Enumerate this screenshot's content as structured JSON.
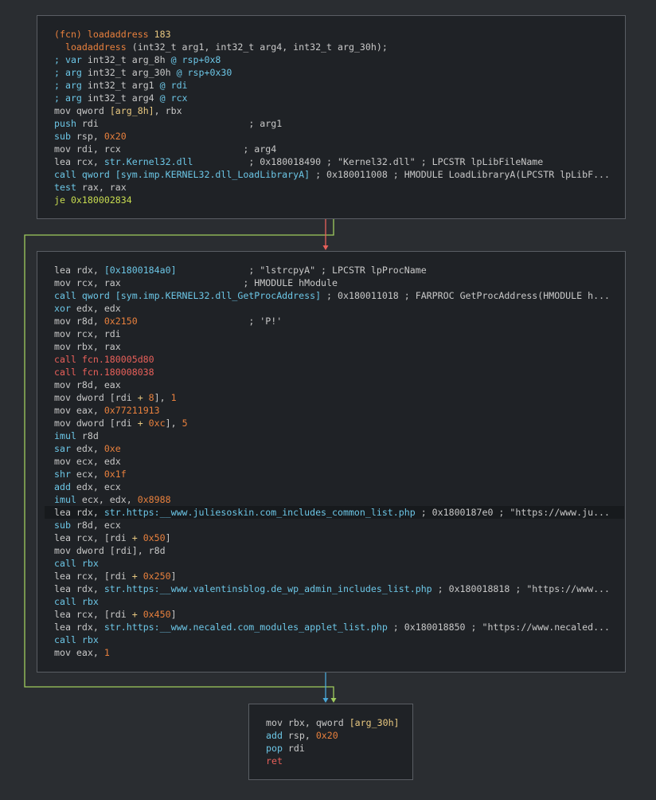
{
  "colors": {
    "background": "#2a2d31",
    "block_bg": "#1f2226",
    "block_border": "#5a5e64",
    "edge_true": "#9fcc5e",
    "edge_false": "#e8605a",
    "edge_uncond": "#4aa8d8"
  },
  "blocks": [
    {
      "id": "block-entry",
      "lines": [
        [
          [
            "c-fcn",
            "(fcn) loadaddress "
          ],
          [
            "c-num2",
            "183"
          ]
        ],
        [
          [
            "c-def",
            "  "
          ],
          [
            "c-fcn",
            "loadaddress"
          ],
          [
            "c-def",
            " (int32_t arg1, int32_t arg4, int32_t arg_30h);"
          ]
        ],
        [
          [
            "c-cmt",
            "; var "
          ],
          [
            "c-def",
            "int32_t arg_8h "
          ],
          [
            "c-cmt",
            "@ rsp+0x8"
          ]
        ],
        [
          [
            "c-cmt",
            "; arg "
          ],
          [
            "c-def",
            "int32_t arg_30h "
          ],
          [
            "c-cmt",
            "@ rsp+0x30"
          ]
        ],
        [
          [
            "c-cmt",
            "; arg "
          ],
          [
            "c-def",
            "int32_t arg1 "
          ],
          [
            "c-cmt",
            "@ rdi"
          ]
        ],
        [
          [
            "c-cmt",
            "; arg "
          ],
          [
            "c-def",
            "int32_t arg4 "
          ],
          [
            "c-cmt",
            "@ rcx"
          ]
        ],
        [
          [
            "c-mnem",
            "mov "
          ],
          [
            "c-reg",
            "qword "
          ],
          [
            "c-stack",
            "[arg_8h]"
          ],
          [
            "c-reg",
            ", rbx"
          ]
        ],
        [
          [
            "c-ctrl",
            "push "
          ],
          [
            "c-reg",
            "rdi                           "
          ],
          [
            "c-ref",
            "; arg1"
          ]
        ],
        [
          [
            "c-ctrl",
            "sub "
          ],
          [
            "c-reg",
            "rsp, "
          ],
          [
            "c-num",
            "0x20"
          ]
        ],
        [
          [
            "c-mnem",
            "mov "
          ],
          [
            "c-reg",
            "rdi, rcx                      "
          ],
          [
            "c-ref",
            "; arg4"
          ]
        ],
        [
          [
            "c-mnem",
            "lea "
          ],
          [
            "c-reg",
            "rcx, "
          ],
          [
            "c-sym",
            "str.Kernel32.dll"
          ],
          [
            "c-ref",
            "          ; 0x180018490 ; \"Kernel32.dll\" ; LPCSTR lpLibFileName"
          ]
        ],
        [
          [
            "c-call",
            "call "
          ],
          [
            "c-sym",
            "qword [sym.imp.KERNEL32.dll_LoadLibraryA]"
          ],
          [
            "c-ref",
            " ; 0x180011008 ; HMODULE LoadLibraryA(LPCSTR lpLibF..."
          ]
        ],
        [
          [
            "c-ctrl",
            "test "
          ],
          [
            "c-reg",
            "rax, rax"
          ]
        ],
        [
          [
            "c-cj",
            "je "
          ],
          [
            "c-cj",
            "0x180002834"
          ]
        ]
      ]
    },
    {
      "id": "block-body",
      "lines": [
        [
          [
            "c-mnem",
            "lea "
          ],
          [
            "c-reg",
            "rdx, "
          ],
          [
            "c-sym",
            "[0x1800184a0]"
          ],
          [
            "c-ref",
            "             ; \"lstrcpyA\" ; LPCSTR lpProcName"
          ]
        ],
        [
          [
            "c-mnem",
            "mov "
          ],
          [
            "c-reg",
            "rcx, rax                      "
          ],
          [
            "c-ref",
            "; HMODULE hModule"
          ]
        ],
        [
          [
            "c-call",
            "call "
          ],
          [
            "c-sym",
            "qword [sym.imp.KERNEL32.dll_GetProcAddress]"
          ],
          [
            "c-ref",
            " ; 0x180011018 ; FARPROC GetProcAddress(HMODULE h..."
          ]
        ],
        [
          [
            "c-ctrl",
            "xor "
          ],
          [
            "c-reg",
            "edx, edx"
          ]
        ],
        [
          [
            "c-mnem",
            "mov "
          ],
          [
            "c-reg",
            "r8d, "
          ],
          [
            "c-num",
            "0x2150"
          ],
          [
            "c-ref",
            "                    ; 'P!'"
          ]
        ],
        [
          [
            "c-mnem",
            "mov "
          ],
          [
            "c-reg",
            "rcx, rdi"
          ]
        ],
        [
          [
            "c-mnem",
            "mov "
          ],
          [
            "c-reg",
            "rbx, rax"
          ]
        ],
        [
          [
            "c-func",
            "call "
          ],
          [
            "c-func",
            "fcn.180005d80"
          ]
        ],
        [
          [
            "c-func",
            "call "
          ],
          [
            "c-func",
            "fcn.180008038"
          ]
        ],
        [
          [
            "c-mnem",
            "mov "
          ],
          [
            "c-reg",
            "r8d, eax"
          ]
        ],
        [
          [
            "c-mnem",
            "mov "
          ],
          [
            "c-reg",
            "dword [rdi "
          ],
          [
            "c-op",
            "+ "
          ],
          [
            "c-num",
            "8"
          ],
          [
            "c-reg",
            "], "
          ],
          [
            "c-num",
            "1"
          ]
        ],
        [
          [
            "c-mnem",
            "mov "
          ],
          [
            "c-reg",
            "eax, "
          ],
          [
            "c-num",
            "0x77211913"
          ]
        ],
        [
          [
            "c-mnem",
            "mov "
          ],
          [
            "c-reg",
            "dword [rdi "
          ],
          [
            "c-op",
            "+ "
          ],
          [
            "c-num",
            "0xc"
          ],
          [
            "c-reg",
            "], "
          ],
          [
            "c-num",
            "5"
          ]
        ],
        [
          [
            "c-ctrl",
            "imul "
          ],
          [
            "c-reg",
            "r8d"
          ]
        ],
        [
          [
            "c-ctrl",
            "sar "
          ],
          [
            "c-reg",
            "edx, "
          ],
          [
            "c-num",
            "0xe"
          ]
        ],
        [
          [
            "c-mnem",
            "mov "
          ],
          [
            "c-reg",
            "ecx, edx"
          ]
        ],
        [
          [
            "c-ctrl",
            "shr "
          ],
          [
            "c-reg",
            "ecx, "
          ],
          [
            "c-num",
            "0x1f"
          ]
        ],
        [
          [
            "c-ctrl",
            "add "
          ],
          [
            "c-reg",
            "edx, ecx"
          ]
        ],
        [
          [
            "c-ctrl",
            "imul "
          ],
          [
            "c-reg",
            "ecx, edx, "
          ],
          [
            "c-num",
            "0x8988"
          ]
        ],
        [
          [
            "c-mnem",
            "lea "
          ],
          [
            "c-reg",
            "rdx, "
          ],
          [
            "c-sym",
            "str.https:__www.juliesoskin.com_includes_common_list.php"
          ],
          [
            "c-ref",
            " ; 0x1800187e0 ; \"https://www.ju..."
          ]
        ],
        [
          [
            "c-ctrl",
            "sub "
          ],
          [
            "c-reg",
            "r8d, ecx"
          ]
        ],
        [
          [
            "c-mnem",
            "lea "
          ],
          [
            "c-reg",
            "rcx, [rdi "
          ],
          [
            "c-op",
            "+ "
          ],
          [
            "c-num",
            "0x50"
          ],
          [
            "c-reg",
            "]"
          ]
        ],
        [
          [
            "c-mnem",
            "mov "
          ],
          [
            "c-reg",
            "dword [rdi], r8d"
          ]
        ],
        [
          [
            "c-call",
            "call "
          ],
          [
            "c-call",
            "rbx"
          ]
        ],
        [
          [
            "c-mnem",
            "lea "
          ],
          [
            "c-reg",
            "rcx, [rdi "
          ],
          [
            "c-op",
            "+ "
          ],
          [
            "c-num",
            "0x250"
          ],
          [
            "c-reg",
            "]"
          ]
        ],
        [
          [
            "c-mnem",
            "lea "
          ],
          [
            "c-reg",
            "rdx, "
          ],
          [
            "c-sym",
            "str.https:__www.valentinsblog.de_wp_admin_includes_list.php"
          ],
          [
            "c-ref",
            " ; 0x180018818 ; \"https://www..."
          ]
        ],
        [
          [
            "c-call",
            "call "
          ],
          [
            "c-call",
            "rbx"
          ]
        ],
        [
          [
            "c-mnem",
            "lea "
          ],
          [
            "c-reg",
            "rcx, [rdi "
          ],
          [
            "c-op",
            "+ "
          ],
          [
            "c-num",
            "0x450"
          ],
          [
            "c-reg",
            "]"
          ]
        ],
        [
          [
            "c-mnem",
            "lea "
          ],
          [
            "c-reg",
            "rdx, "
          ],
          [
            "c-sym",
            "str.https:__www.necaled.com_modules_applet_list.php"
          ],
          [
            "c-ref",
            " ; 0x180018850 ; \"https://www.necaled..."
          ]
        ],
        [
          [
            "c-call",
            "call "
          ],
          [
            "c-call",
            "rbx"
          ]
        ],
        [
          [
            "c-mnem",
            "mov "
          ],
          [
            "c-reg",
            "eax, "
          ],
          [
            "c-num",
            "1"
          ]
        ]
      ]
    },
    {
      "id": "block-exit",
      "lines": [
        [
          [
            "c-mnem",
            "mov "
          ],
          [
            "c-reg",
            "rbx, qword "
          ],
          [
            "c-stack",
            "[arg_30h]"
          ]
        ],
        [
          [
            "c-ctrl",
            "add "
          ],
          [
            "c-reg",
            "rsp, "
          ],
          [
            "c-num",
            "0x20"
          ]
        ],
        [
          [
            "c-ctrl",
            "pop "
          ],
          [
            "c-reg",
            "rdi"
          ]
        ],
        [
          [
            "c-ret",
            "ret"
          ]
        ]
      ]
    }
  ]
}
